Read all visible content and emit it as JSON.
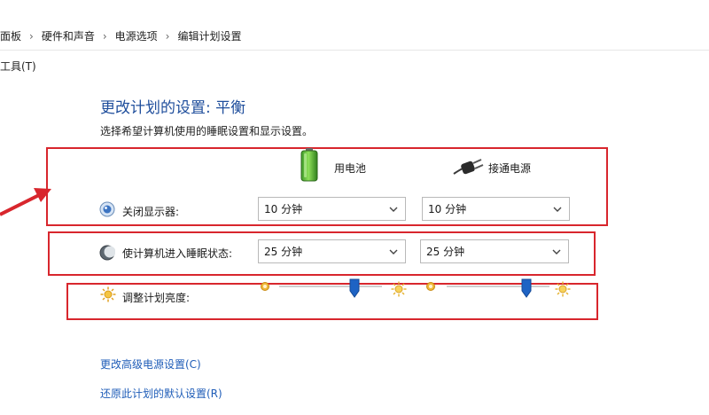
{
  "breadcrumb": {
    "items": [
      "面板",
      "硬件和声音",
      "电源选项",
      "编辑计划设置"
    ]
  },
  "menu": {
    "tools": "工具(T)"
  },
  "header": {
    "title": "更改计划的设置: 平衡",
    "subtitle": "选择希望计算机使用的睡眠设置和显示设置。"
  },
  "columns": {
    "battery": "用电池",
    "plugged": "接通电源"
  },
  "settings": {
    "display": {
      "label": "关闭显示器:",
      "battery_value": "10 分钟",
      "plugged_value": "10 分钟"
    },
    "sleep": {
      "label": "使计算机进入睡眠状态:",
      "battery_value": "25 分钟",
      "plugged_value": "25 分钟"
    },
    "brightness": {
      "label": "调整计划亮度:",
      "battery_level": 0.73,
      "plugged_level": 0.78
    }
  },
  "links": {
    "advanced": "更改高级电源设置(C)",
    "restore": "还原此计划的默认设置(R)"
  },
  "colors": {
    "accent": "#1f4e9c",
    "highlight": "#d8262d",
    "link": "#1f5db8",
    "slider_thumb": "#1e63c4"
  }
}
